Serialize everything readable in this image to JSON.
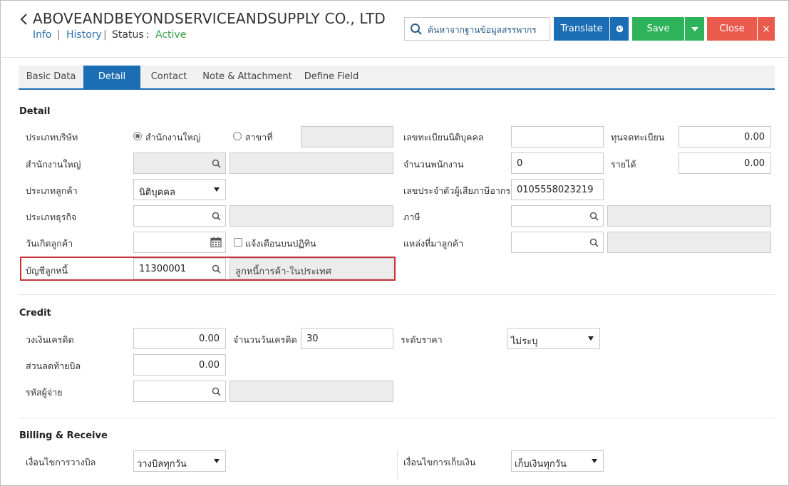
{
  "header": {
    "title": "ABOVEANDBEYONDSERVICEANDSUPPLY CO., LTD",
    "links": {
      "info": "Info",
      "history": "History",
      "separator": "|"
    },
    "status_label": "Status",
    "status_colon": ":",
    "status_value": "Active",
    "search_placeholder": "ค้นหาจากฐานข้อมูลสรรพากร",
    "buttons": {
      "translate": "Translate",
      "save": "Save",
      "close": "Close",
      "close_x": "×"
    }
  },
  "tabs": [
    "Basic Data",
    "Detail",
    "Contact",
    "Note & Attachment",
    "Define Field"
  ],
  "active_tab": "Detail",
  "detail": {
    "section_title": "Detail",
    "company_type_label": "ประเภทบริษัท",
    "company_type_options": [
      "สำนักงานใหญ่",
      "สาขาที่"
    ],
    "company_type_selected": "สำนักงานใหญ่",
    "head_office_label": "สำนักงานใหญ่",
    "customer_type_label": "ประเภทลูกค้า",
    "customer_type_value": "นิติบุคคล",
    "business_type_label": "ประเภทธุรกิจ",
    "customer_birthday_label": "วันเกิดลูกค้า",
    "calendar_notify_label": "แจ้งเตือนบนปฏิทิน",
    "receivable_account_label": "บัญชีลูกหนี้",
    "receivable_account_code": "11300001",
    "receivable_account_name": "ลูกหนี้การค้า-ในประเทศ",
    "juristic_reg_no_label": "เลขทะเบียนนิติบุคคล",
    "registered_capital_label": "ทุนจดทะเบียน",
    "registered_capital_value": "0.00",
    "employee_count_label": "จำนวนพนักงาน",
    "employee_count_value": "0",
    "income_label": "รายได้",
    "income_value": "0.00",
    "tax_id_label": "เลขประจำตัวผู้เสียภาษีอากร",
    "tax_id_value": "0105558023219",
    "tax_label": "ภาษี",
    "customer_source_label": "แหล่งที่มาลูกค้า"
  },
  "credit": {
    "section_title": "Credit",
    "credit_limit_label": "วงเงินเครดิต",
    "credit_limit_value": "0.00",
    "credit_days_label": "จำนวนวันเครดิต",
    "credit_days_value": "30",
    "price_level_label": "ระดับราคา",
    "price_level_value": "ไม่ระบุ",
    "bill_discount_label": "ส่วนลดท้ายบิล",
    "bill_discount_value": "0.00",
    "payer_code_label": "รหัสผู้จ่าย"
  },
  "billing": {
    "section_title": "Billing & Receive",
    "billing_condition_label": "เงื่อนไขการวางบิล",
    "billing_condition_value": "วางบิลทุกวัน",
    "collection_condition_label": "เงื่อนไขการเก็บเงิน",
    "collection_condition_value": "เก็บเงินทุกวัน"
  },
  "colors": {
    "primary": "#1b6db4",
    "save": "#2fb35a",
    "close": "#ea5a4d",
    "status_active": "#3aa14a",
    "link": "#2a6fb0",
    "highlight": "#c8333b"
  },
  "icons": [
    "chevron-left-icon",
    "search-icon",
    "globe-icon",
    "caret-down-icon",
    "close-icon",
    "calendar-icon"
  ]
}
